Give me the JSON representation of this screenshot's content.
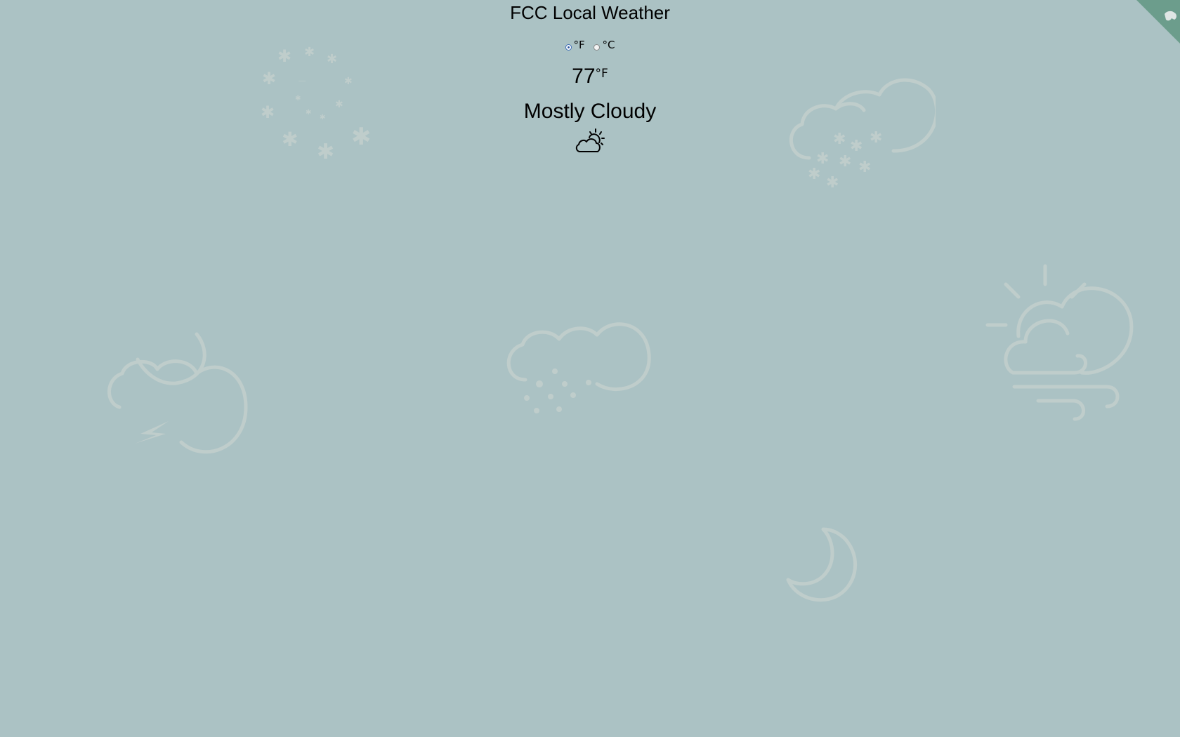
{
  "header": {
    "title": "FCC Local Weather"
  },
  "units": {
    "selected": "fahrenheit",
    "options": [
      {
        "id": "fahrenheit",
        "label": "°F",
        "checked": true
      },
      {
        "id": "celsius",
        "label": "°C",
        "checked": false
      }
    ]
  },
  "current": {
    "temperature": "77",
    "temperature_unit": "°F",
    "condition": "Mostly Cloudy",
    "condition_icon": "partly-cloudy-day-icon"
  },
  "background_icons": [
    "snowflakes-icon",
    "cloud-snow-icon",
    "wind-partly-cloudy-icon",
    "night-thunderstorm-icon",
    "cloud-sleet-icon",
    "moon-icon"
  ],
  "corner": {
    "icon": "github-corner-icon",
    "color": "#6c9d8c"
  },
  "colors": {
    "background": "#abc2c4",
    "bg_icon": "#c3cfcd",
    "text": "#000000"
  }
}
